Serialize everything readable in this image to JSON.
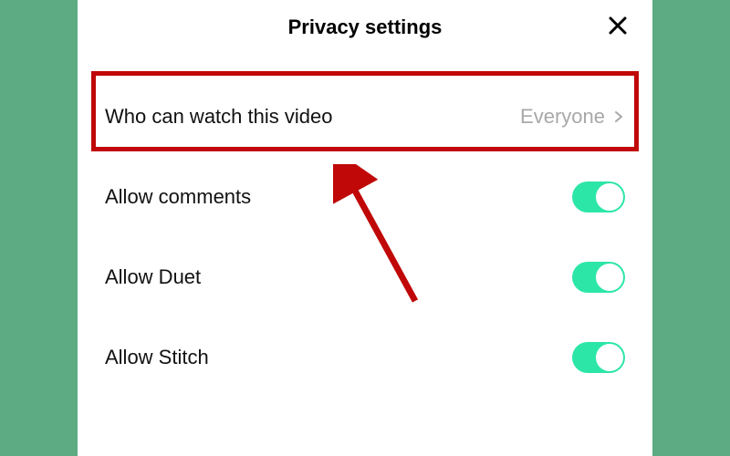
{
  "header": {
    "title": "Privacy settings"
  },
  "rows": {
    "who_can_watch": {
      "label": "Who can watch this video",
      "value": "Everyone"
    },
    "allow_comments": {
      "label": "Allow comments",
      "enabled": true
    },
    "allow_duet": {
      "label": "Allow Duet",
      "enabled": true
    },
    "allow_stitch": {
      "label": "Allow Stitch",
      "enabled": true
    }
  },
  "colors": {
    "toggle_on": "#2ce6a8",
    "highlight_border": "#c00808",
    "page_bg": "#5cab83"
  }
}
